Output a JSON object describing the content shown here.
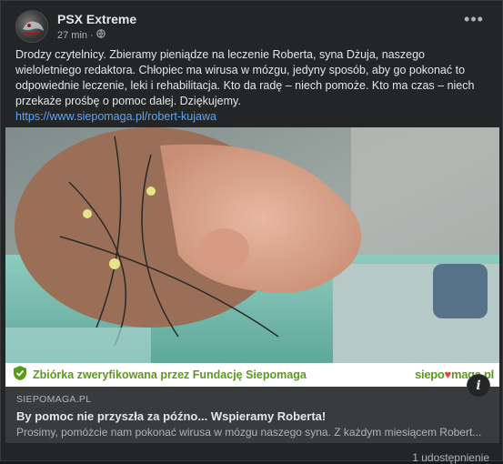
{
  "header": {
    "page_name": "PSX Extreme",
    "time": "27 min",
    "separator": "·",
    "audience_icon": "globe-icon",
    "more_label": "•••"
  },
  "post": {
    "text": "Drodzy czytelnicy. Zbieramy pieniądze na leczenie Roberta, syna Dżuja, naszego wieloletniego redaktora. Chłopiec ma wirusa w mózgu, jedyny sposób, aby go pokonać to odpowiednie leczenie, leki i rehabilitacja. Kto da radę – niech pomoże. Kto ma czas – niech przekaże prośbę o pomoc dalej. Dziękujemy.",
    "link": "https://www.siepomaga.pl/robert-kujawa"
  },
  "banner": {
    "text": "Zbiórka zweryfikowana przez Fundację Siepomaga",
    "logo_prefix": "siepo",
    "logo_heart": "♥",
    "logo_suffix": "maga.pl"
  },
  "link_preview": {
    "domain": "SIEPOMAGA.PL",
    "title": "By pomoc nie przyszła za późno... Wspieramy Roberta!",
    "description": "Prosimy, pomóżcie nam pokonać wirusa w mózgu naszego syna. Z każdym miesiącem Robert...",
    "info_label": "i"
  },
  "footer": {
    "shares": "1 udostępnienie"
  },
  "colors": {
    "background": "#242526",
    "link": "#5aa7f5",
    "siepomaga_green": "#5c9a1c"
  }
}
